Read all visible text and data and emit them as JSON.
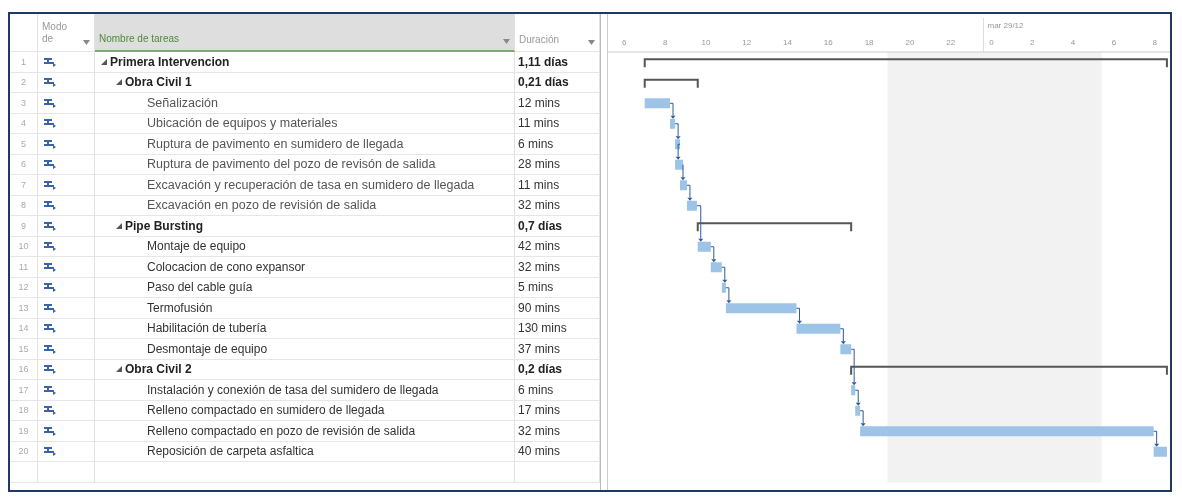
{
  "table": {
    "columns": [
      {
        "label": "Modo de",
        "selected": false
      },
      {
        "label": "Nombre de tareas",
        "selected": true
      },
      {
        "label": "Duración",
        "selected": false
      }
    ],
    "rows": [
      {
        "id": "1",
        "kind": "summary",
        "name": "Primera Intervencion",
        "duration": "1,11 días",
        "expanded": true,
        "children": [
          {
            "id": "2",
            "kind": "summary",
            "name": "Obra Civil 1",
            "duration": "0,21 días",
            "expanded": true,
            "children": [
              {
                "id": "3",
                "kind": "task",
                "name": "Señalización",
                "duration": "12 mins"
              },
              {
                "id": "4",
                "kind": "task",
                "name": "Ubicación de equipos y materiales",
                "duration": "11 mins"
              },
              {
                "id": "5",
                "kind": "task",
                "name": "Ruptura de pavimento en sumidero de llegada",
                "duration": "6 mins"
              },
              {
                "id": "6",
                "kind": "task",
                "name": "Ruptura de pavimento del pozo de revisón de salida",
                "duration": "28 mins"
              },
              {
                "id": "7",
                "kind": "task",
                "name": "Excavación y recuperación de tasa en sumidero de llegada",
                "duration": "11 mins"
              },
              {
                "id": "8",
                "kind": "task",
                "name": "Excavación en pozo de revisión de salida",
                "duration": "32 mins"
              }
            ]
          },
          {
            "id": "9",
            "kind": "summary",
            "name": "Pipe Bursting",
            "duration": "0,7 días",
            "expanded": true,
            "children": [
              {
                "id": "10",
                "kind": "task",
                "name": "Montaje de equipo",
                "duration": "42 mins"
              },
              {
                "id": "11",
                "kind": "task",
                "name": "Colocacion de cono expansor",
                "duration": "32 mins"
              },
              {
                "id": "12",
                "kind": "task",
                "name": "Paso del cable guía",
                "duration": "5 mins"
              },
              {
                "id": "13",
                "kind": "task",
                "name": "Termofusión",
                "duration": "90 mins"
              },
              {
                "id": "14",
                "kind": "task",
                "name": "Habilitación de tubería",
                "duration": "130 mins"
              },
              {
                "id": "15",
                "kind": "task",
                "name": "Desmontaje de equipo",
                "duration": "37 mins"
              }
            ]
          },
          {
            "id": "16",
            "kind": "summary",
            "name": "Obra Civil 2",
            "duration": "0,2 días",
            "expanded": true,
            "children": [
              {
                "id": "17",
                "kind": "task",
                "name": "Instalación y conexión de tasa del sumidero de llegada",
                "duration": "6 mins"
              },
              {
                "id": "18",
                "kind": "task",
                "name": "Relleno compactado en sumidero de llegada",
                "duration": "17 mins"
              },
              {
                "id": "19",
                "kind": "task",
                "name": "Relleno compactado en pozo de revisión de salida",
                "duration": "32 mins"
              },
              {
                "id": "20",
                "kind": "task",
                "name": "Reposición de carpeta asfaltica",
                "duration": "40 mins"
              }
            ]
          }
        ]
      }
    ]
  },
  "gantt": {
    "timescale": {
      "date": "mar 29/12",
      "hours": [
        "6",
        "8",
        "10",
        "12",
        "14",
        "16",
        "18",
        "20",
        "22",
        "0",
        "2",
        "4",
        "6",
        "8"
      ]
    }
  }
}
